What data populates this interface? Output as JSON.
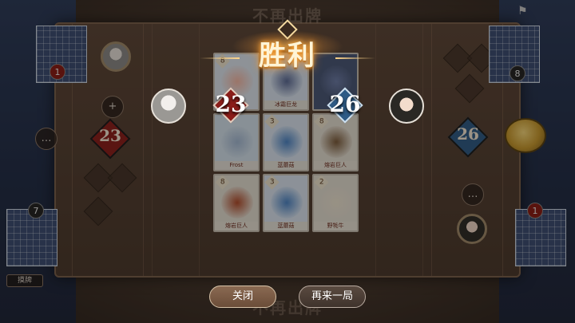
{
  "background": {
    "faded_top": "不再出牌",
    "faded_bottom": "不再出牌"
  },
  "left_player": {
    "hand_count": "1",
    "deck_count": "7",
    "score": "23",
    "hand_label": "摸牌"
  },
  "right_player": {
    "hand_count": "8",
    "deck_count": "1",
    "score": "26"
  },
  "cards": [
    {
      "cost": "8",
      "name": "",
      "color": "#dfe7f0",
      "art": "#f4b8a6"
    },
    {
      "cost": "",
      "name": "冰霜巨龙",
      "color": "#dbe6f3",
      "art": "#5a6a96"
    },
    {
      "cost": "",
      "name": "",
      "color": "#4a5878",
      "art": "#6c7ca8"
    },
    {
      "cost": "",
      "name": "Frost",
      "color": "#d6e4ef",
      "art": "#a3b9d4"
    },
    {
      "cost": "3",
      "name": "蓝蘑菇",
      "color": "#dbe6f3",
      "art": "#4b84c6"
    },
    {
      "cost": "8",
      "name": "熔岩巨人",
      "color": "#e6e0d4",
      "art": "#7a5a3a"
    },
    {
      "cost": "8",
      "name": "熔岩巨人",
      "color": "#e6e0d4",
      "art": "#b04a2a"
    },
    {
      "cost": "3",
      "name": "蓝蘑菇",
      "color": "#dbe6f3",
      "art": "#4b84c6"
    },
    {
      "cost": "2",
      "name": "野牦牛",
      "color": "#e6e0d4",
      "art": "#efe6d2"
    }
  ],
  "result": {
    "title": "胜利",
    "left_score": "23",
    "right_score": "26"
  },
  "buttons": {
    "close": "关闭",
    "again": "再来一局"
  },
  "colors": {
    "left_diamond": "#8b1d1a",
    "right_diamond": "#2e5b86",
    "victory_glow": "#ffb347"
  }
}
